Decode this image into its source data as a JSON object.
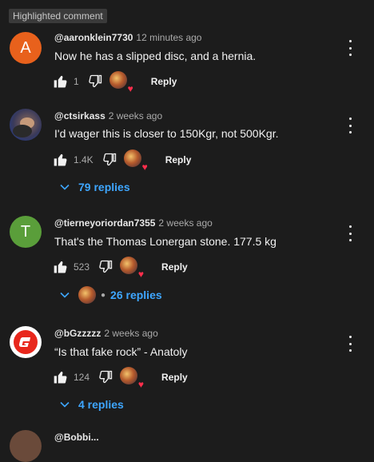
{
  "highlight_label": "Highlighted comment",
  "colors": {
    "background": "#1c1c1c",
    "link": "#3ea6ff",
    "heart": "#ff2e4c"
  },
  "comments": [
    {
      "author": "@aaronklein7730",
      "time": "12 minutes ago",
      "text": "Now he has a slipped disc, and a hernia.",
      "likes": "1",
      "reply_label": "Reply",
      "avatar_letter": "A",
      "avatar_color": "#e8611c",
      "replies": ""
    },
    {
      "author": "@ctsirkass",
      "time": "2 weeks ago",
      "text": "I'd wager this is closer to 150Kgr, not 500Kgr.",
      "likes": "1.4K",
      "reply_label": "Reply",
      "avatar_letter": "",
      "avatar_color": "#4b5a8a",
      "replies": "79 replies"
    },
    {
      "author": "@tierneyoriordan7355",
      "time": "2 weeks ago",
      "text": "That's the Thomas Lonergan stone. 177.5 kg",
      "likes": "523",
      "reply_label": "Reply",
      "avatar_letter": "T",
      "avatar_color": "#5a9e3a",
      "replies": "26 replies"
    },
    {
      "author": "@bGzzzzz",
      "time": "2 weeks ago",
      "text": "“Is that fake rock” - Anatoly",
      "likes": "124",
      "reply_label": "Reply",
      "avatar_letter": "",
      "avatar_color": "#ffffff",
      "replies": "4 replies"
    }
  ],
  "partial_author": "@Bobbi..."
}
